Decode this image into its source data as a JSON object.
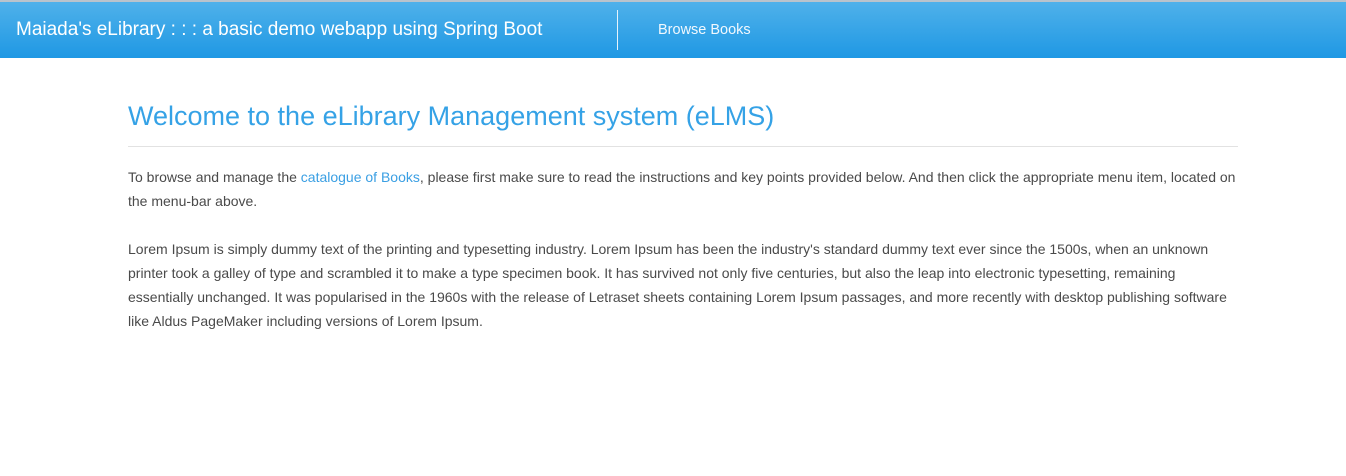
{
  "navbar": {
    "brand": "Maiada's eLibrary : : : a basic demo webapp using Spring Boot",
    "links": [
      {
        "label": "Browse Books"
      }
    ]
  },
  "main": {
    "title": "Welcome to the eLibrary Management system (eLMS)",
    "intro_before": "To browse and manage the ",
    "intro_link": "catalogue of Books",
    "intro_after": ", please first make sure to read the instructions and key points provided below. And then click the appropriate menu item, located on the menu-bar above.",
    "lorem": "Lorem Ipsum is simply dummy text of the printing and typesetting industry. Lorem Ipsum has been the industry's standard dummy text ever since the 1500s, when an unknown printer took a galley of type and scrambled it to make a type specimen book. It has survived not only five centuries, but also the leap into electronic typesetting, remaining essentially unchanged. It was popularised in the 1960s with the release of Letraset sheets containing Lorem Ipsum passages, and more recently with desktop publishing software like Aldus PageMaker including versions of Lorem Ipsum."
  },
  "colors": {
    "navbar": "#2a9fe6",
    "accent": "#35a2e6"
  }
}
